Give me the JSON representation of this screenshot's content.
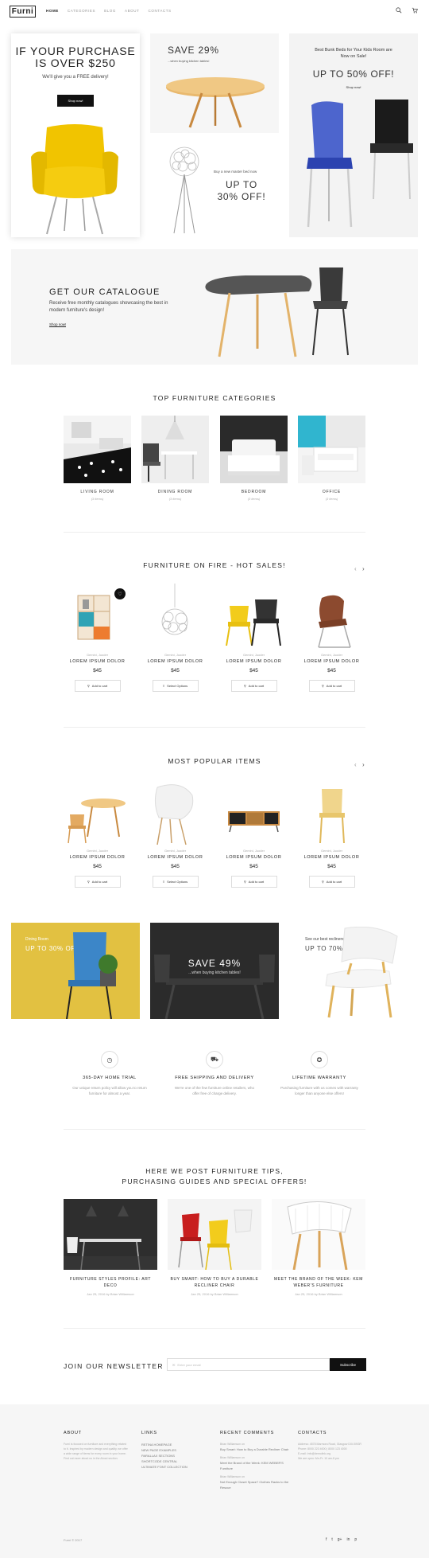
{
  "header": {
    "logo": "Furni",
    "nav": [
      "HOME",
      "CATEGORIES",
      "BLOG",
      "ABOUT",
      "CONTACTS"
    ],
    "search_icon": "search-icon",
    "cart_icon": "cart-icon"
  },
  "promo": {
    "p1_title": "IF YOUR PURCHASE IS OVER $250",
    "p1_sub": "We'll give you a FREE delivery!",
    "p1_btn": "Shop now!",
    "p2_title": "SAVE 29%",
    "p2_sub": "...when buying kitchen tables!",
    "p3_sub": "Buy a new master bed now",
    "p3_title": "UP TO 30% OFF!",
    "p4_sub": "Best Bunk Beds for Your Kids Room are Now on Sale!",
    "p4_title": "UP TO 50% OFF!",
    "p4_link": "Shop now!"
  },
  "catalogue": {
    "title": "GET OUR CATALOGUE",
    "sub": "Receive free monthly catalogues showcasing the best in modern furniture's design!",
    "link": "Shop now!"
  },
  "categories": {
    "title": "TOP FURNITURE CATEGORIES",
    "items": [
      {
        "name": "LIVING ROOM",
        "count": "(3 items)"
      },
      {
        "name": "DINING ROOM",
        "count": "(3 items)"
      },
      {
        "name": "BEDROOM",
        "count": "(3 items)"
      },
      {
        "name": "OFFICE",
        "count": "(3 items)"
      }
    ]
  },
  "hot_sales": {
    "title": "FURNITURE ON FIRE - HOT SALES!",
    "items": [
      {
        "cat": "Gemini, Juoder",
        "name": "LOREM IPSUM DOLOR",
        "price": "$45",
        "btn": "Add to cart"
      },
      {
        "cat": "Gemini, Juoder",
        "name": "LOREM IPSUM DOLOR",
        "price": "$45",
        "btn": "Select Options"
      },
      {
        "cat": "Gemini, Juoder",
        "name": "LOREM IPSUM DOLOR",
        "price": "$45",
        "btn": "Add to cart"
      },
      {
        "cat": "Gemini, Juoder",
        "name": "LOREM IPSUM DOLOR",
        "price": "$45",
        "btn": "Add to cart"
      }
    ]
  },
  "popular": {
    "title": "MOST POPULAR ITEMS",
    "items": [
      {
        "cat": "Gemini, Juoder",
        "name": "LOREM IPSUM DOLOR",
        "price": "$45",
        "btn": "Add to cart"
      },
      {
        "cat": "Gemini, Juoder",
        "name": "LOREM IPSUM DOLOR",
        "price": "$45",
        "btn": "Select Options"
      },
      {
        "cat": "Gemini, Juoder",
        "name": "LOREM IPSUM DOLOR",
        "price": "$45",
        "btn": "Add to cart"
      },
      {
        "cat": "Gemini, Juoder",
        "name": "LOREM IPSUM DOLOR",
        "price": "$45",
        "btn": "Add to cart"
      }
    ]
  },
  "banners": {
    "b1_sub": "Dining Room",
    "b1_title": "UP TO 30% OFF!",
    "b2_title": "SAVE 49%",
    "b2_sub": "...when buying kitchen tables!",
    "b3_sub": "See our best recliners",
    "b3_title": "UP TO 70% OFF"
  },
  "features": [
    {
      "title": "365-DAY HOME TRIAL",
      "desc": "Our unique return policy will allow you to return furniture for almost a year."
    },
    {
      "title": "FREE SHIPPING AND DELIVERY",
      "desc": "We're one of the few furniture online retailers, who offer free of charge delivery."
    },
    {
      "title": "LIFETIME WARRANTY",
      "desc": "Purchasing furniture with us comes with warranty longer than anyone else offers!"
    }
  ],
  "blog": {
    "title1": "HERE WE POST FURNITURE TIPS,",
    "title2": "PURCHASING GUIDES AND SPECIAL OFFERS!",
    "posts": [
      {
        "title": "FURNITURE STYLES PROFILE: ART DECO",
        "date": "Jan 25, 2016",
        "by": "by Brian Williamson"
      },
      {
        "title": "BUY SMART: HOW TO BUY A DURABLE RECLINER CHAIR",
        "date": "Jan 25, 2016",
        "by": "by Brian Williamson"
      },
      {
        "title": "MEET THE BRAND OF THE WEEK: KEM WEBER'S FURNITURE",
        "date": "Jan 25, 2016",
        "by": "by Brian Williamson"
      }
    ]
  },
  "newsletter": {
    "title": "JOIN OUR NEWSLETTER",
    "placeholder": "Enter your email",
    "btn": "Subscribe"
  },
  "footer": {
    "about_h": "ABOUT",
    "about_text": "Furni is focused on furniture and everything related to it. Inspired by modern design and quality, we offer a wide range of items for every room in your home. Find out more about us in the About section.",
    "links_h": "LINKS",
    "links": [
      "RETINA HOMEPAGE",
      "NEW PAGE EXAMPLES",
      "PARALLAX SECTIONS",
      "SHORTCODE CENTRAL",
      "ULTIMATE FONT COLLECTION"
    ],
    "comments_h": "RECENT COMMENTS",
    "comments": [
      {
        "by": "Brian Williamson on",
        "text": "Buy Smart: How to Buy a Durable Recliner Chair"
      },
      {
        "by": "Brian Williamson on",
        "text": "Meet the Brand of the Week: KEM WEBER'S Furniture"
      },
      {
        "by": "Brian Williamson on",
        "text": "Not Enough Closet Space? Clothes Racks to the Rescue"
      }
    ],
    "contacts_h": "CONTACTS",
    "contacts": [
      "Address: 4578 Marmora Road, Glasgow D04 89GR",
      "Phone: 8000 223 4000 | 8000 123 4000",
      "E-mail: info@demolink.org",
      "We are open: Mn-Fr: 10 am-8 pm"
    ],
    "copy": "Furni © 2017",
    "social": [
      "f",
      "t",
      "g+",
      "in",
      "p"
    ]
  }
}
